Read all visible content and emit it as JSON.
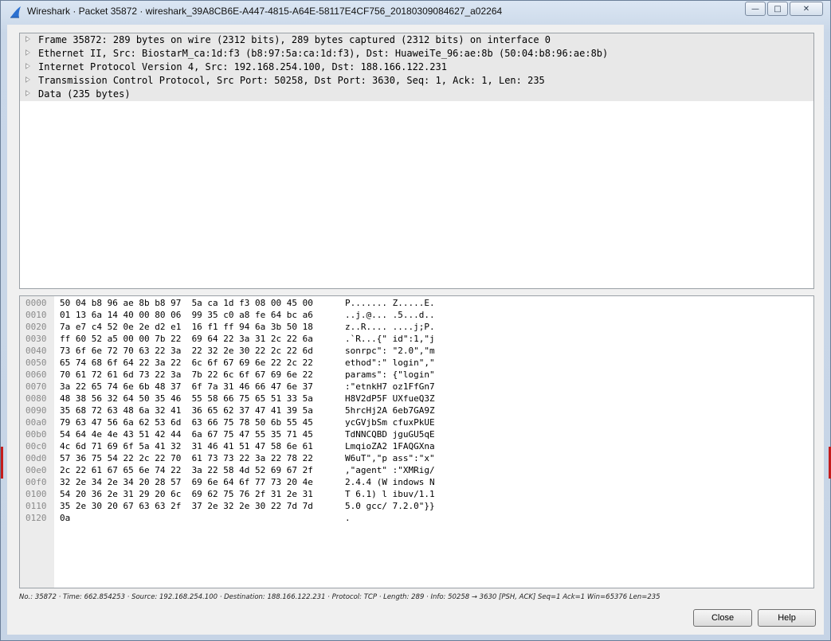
{
  "window": {
    "title": "Wireshark · Packet 35872 · wireshark_39A8CB6E-A447-4815-A64E-58117E4CF756_20180309084627_a02264",
    "minimize_glyph": "—",
    "maximize_glyph": "□",
    "close_glyph": "✕"
  },
  "detail_tree": [
    {
      "label": "Frame 35872: 289 bytes on wire (2312 bits), 289 bytes captured (2312 bits) on interface 0"
    },
    {
      "label": "Ethernet II, Src: BiostarM_ca:1d:f3 (b8:97:5a:ca:1d:f3), Dst: HuaweiTe_96:ae:8b (50:04:b8:96:ae:8b)"
    },
    {
      "label": "Internet Protocol Version 4, Src: 192.168.254.100, Dst: 188.166.122.231"
    },
    {
      "label": "Transmission Control Protocol, Src Port: 50258, Dst Port: 3630, Seq: 1, Ack: 1, Len: 235"
    },
    {
      "label": "Data (235 bytes)"
    }
  ],
  "hex_dump": [
    {
      "offset": "0000",
      "hex": "50 04 b8 96 ae 8b b8 97  5a ca 1d f3 08 00 45 00",
      "ascii": "P....... Z.....E."
    },
    {
      "offset": "0010",
      "hex": "01 13 6a 14 40 00 80 06  99 35 c0 a8 fe 64 bc a6",
      "ascii": "..j.@... .5...d.."
    },
    {
      "offset": "0020",
      "hex": "7a e7 c4 52 0e 2e d2 e1  16 f1 ff 94 6a 3b 50 18",
      "ascii": "z..R.... ....j;P."
    },
    {
      "offset": "0030",
      "hex": "ff 60 52 a5 00 00 7b 22  69 64 22 3a 31 2c 22 6a",
      "ascii": ".`R...{\" id\":1,\"j"
    },
    {
      "offset": "0040",
      "hex": "73 6f 6e 72 70 63 22 3a  22 32 2e 30 22 2c 22 6d",
      "ascii": "sonrpc\": \"2.0\",\"m"
    },
    {
      "offset": "0050",
      "hex": "65 74 68 6f 64 22 3a 22  6c 6f 67 69 6e 22 2c 22",
      "ascii": "ethod\":\" login\",\""
    },
    {
      "offset": "0060",
      "hex": "70 61 72 61 6d 73 22 3a  7b 22 6c 6f 67 69 6e 22",
      "ascii": "params\": {\"login\""
    },
    {
      "offset": "0070",
      "hex": "3a 22 65 74 6e 6b 48 37  6f 7a 31 46 66 47 6e 37",
      "ascii": ":\"etnkH7 oz1FfGn7"
    },
    {
      "offset": "0080",
      "hex": "48 38 56 32 64 50 35 46  55 58 66 75 65 51 33 5a",
      "ascii": "H8V2dP5F UXfueQ3Z"
    },
    {
      "offset": "0090",
      "hex": "35 68 72 63 48 6a 32 41  36 65 62 37 47 41 39 5a",
      "ascii": "5hrcHj2A 6eb7GA9Z"
    },
    {
      "offset": "00a0",
      "hex": "79 63 47 56 6a 62 53 6d  63 66 75 78 50 6b 55 45",
      "ascii": "ycGVjbSm cfuxPkUE"
    },
    {
      "offset": "00b0",
      "hex": "54 64 4e 4e 43 51 42 44  6a 67 75 47 55 35 71 45",
      "ascii": "TdNNCQBD jguGU5qE"
    },
    {
      "offset": "00c0",
      "hex": "4c 6d 71 69 6f 5a 41 32  31 46 41 51 47 58 6e 61",
      "ascii": "LmqioZA2 1FAQGXna"
    },
    {
      "offset": "00d0",
      "hex": "57 36 75 54 22 2c 22 70  61 73 73 22 3a 22 78 22",
      "ascii": "W6uT\",\"p ass\":\"x\""
    },
    {
      "offset": "00e0",
      "hex": "2c 22 61 67 65 6e 74 22  3a 22 58 4d 52 69 67 2f",
      "ascii": ",\"agent\" :\"XMRig/"
    },
    {
      "offset": "00f0",
      "hex": "32 2e 34 2e 34 20 28 57  69 6e 64 6f 77 73 20 4e",
      "ascii": "2.4.4 (W indows N"
    },
    {
      "offset": "0100",
      "hex": "54 20 36 2e 31 29 20 6c  69 62 75 76 2f 31 2e 31",
      "ascii": "T 6.1) l ibuv/1.1"
    },
    {
      "offset": "0110",
      "hex": "35 2e 30 20 67 63 63 2f  37 2e 32 2e 30 22 7d 7d",
      "ascii": "5.0 gcc/ 7.2.0\"}}"
    },
    {
      "offset": "0120",
      "hex": "0a",
      "ascii": "."
    }
  ],
  "status_line": "No.: 35872 · Time: 662.854253 · Source: 192.168.254.100 · Destination: 188.166.122.231 · Protocol: TCP · Length: 289 · Info: 50258 → 3630 [PSH, ACK] Seq=1 Ack=1 Win=65376 Len=235",
  "buttons": {
    "close": "Close",
    "help": "Help"
  },
  "colors": {
    "tree_row_bg": "#e8e8e8",
    "offset_text": "#8a8a8a",
    "gutter_bg": "#ececec",
    "accent_icon": "#2a6fd0"
  }
}
